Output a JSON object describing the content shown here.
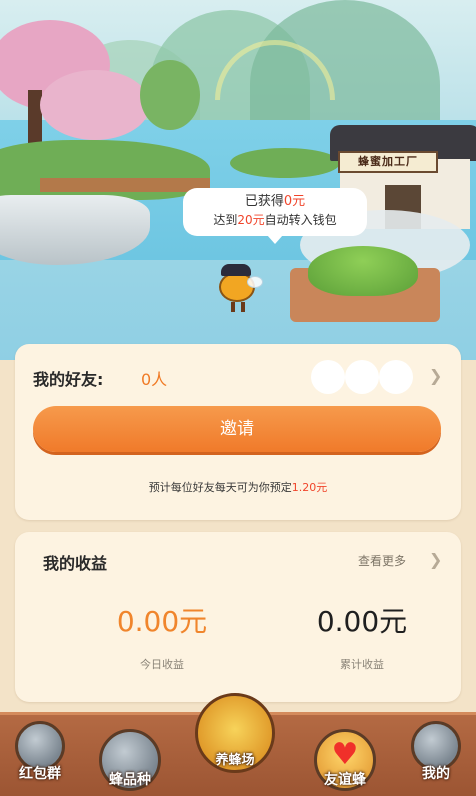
{
  "scene": {
    "factory_sign": "蜂蜜加工厂",
    "bubble_line1_prefix": "已获得",
    "bubble_line1_value": "0元",
    "bubble_line2_prefix": "达到",
    "bubble_line2_value": "20元",
    "bubble_line2_suffix": "自动转入钱包"
  },
  "friends": {
    "label": "我的好友:",
    "count": "0人",
    "invite_button": "邀请",
    "estimate_prefix": "预计每位好友每天可为你预定",
    "estimate_value": "1.20元"
  },
  "earnings": {
    "title": "我的收益",
    "more": "查看更多",
    "today_value": "0.00元",
    "today_label": "今日收益",
    "total_value": "0.00元",
    "total_label": "累计收益"
  },
  "nav": {
    "items": [
      {
        "label": "红包群",
        "icon": "red-packet-group-icon"
      },
      {
        "label": "蜂品种",
        "icon": "bee-species-icon"
      },
      {
        "label": "养蜂场",
        "icon": "apiary-bee-icon",
        "active": true
      },
      {
        "label": "友谊蜂",
        "icon": "heart-icon"
      },
      {
        "label": "我的",
        "icon": "profile-icon"
      }
    ]
  },
  "colors": {
    "accent_orange": "#f07a2a",
    "highlight_red": "#f0452b",
    "card_bg": "#fdf3e1",
    "nav_bg": "#a85e3b"
  }
}
